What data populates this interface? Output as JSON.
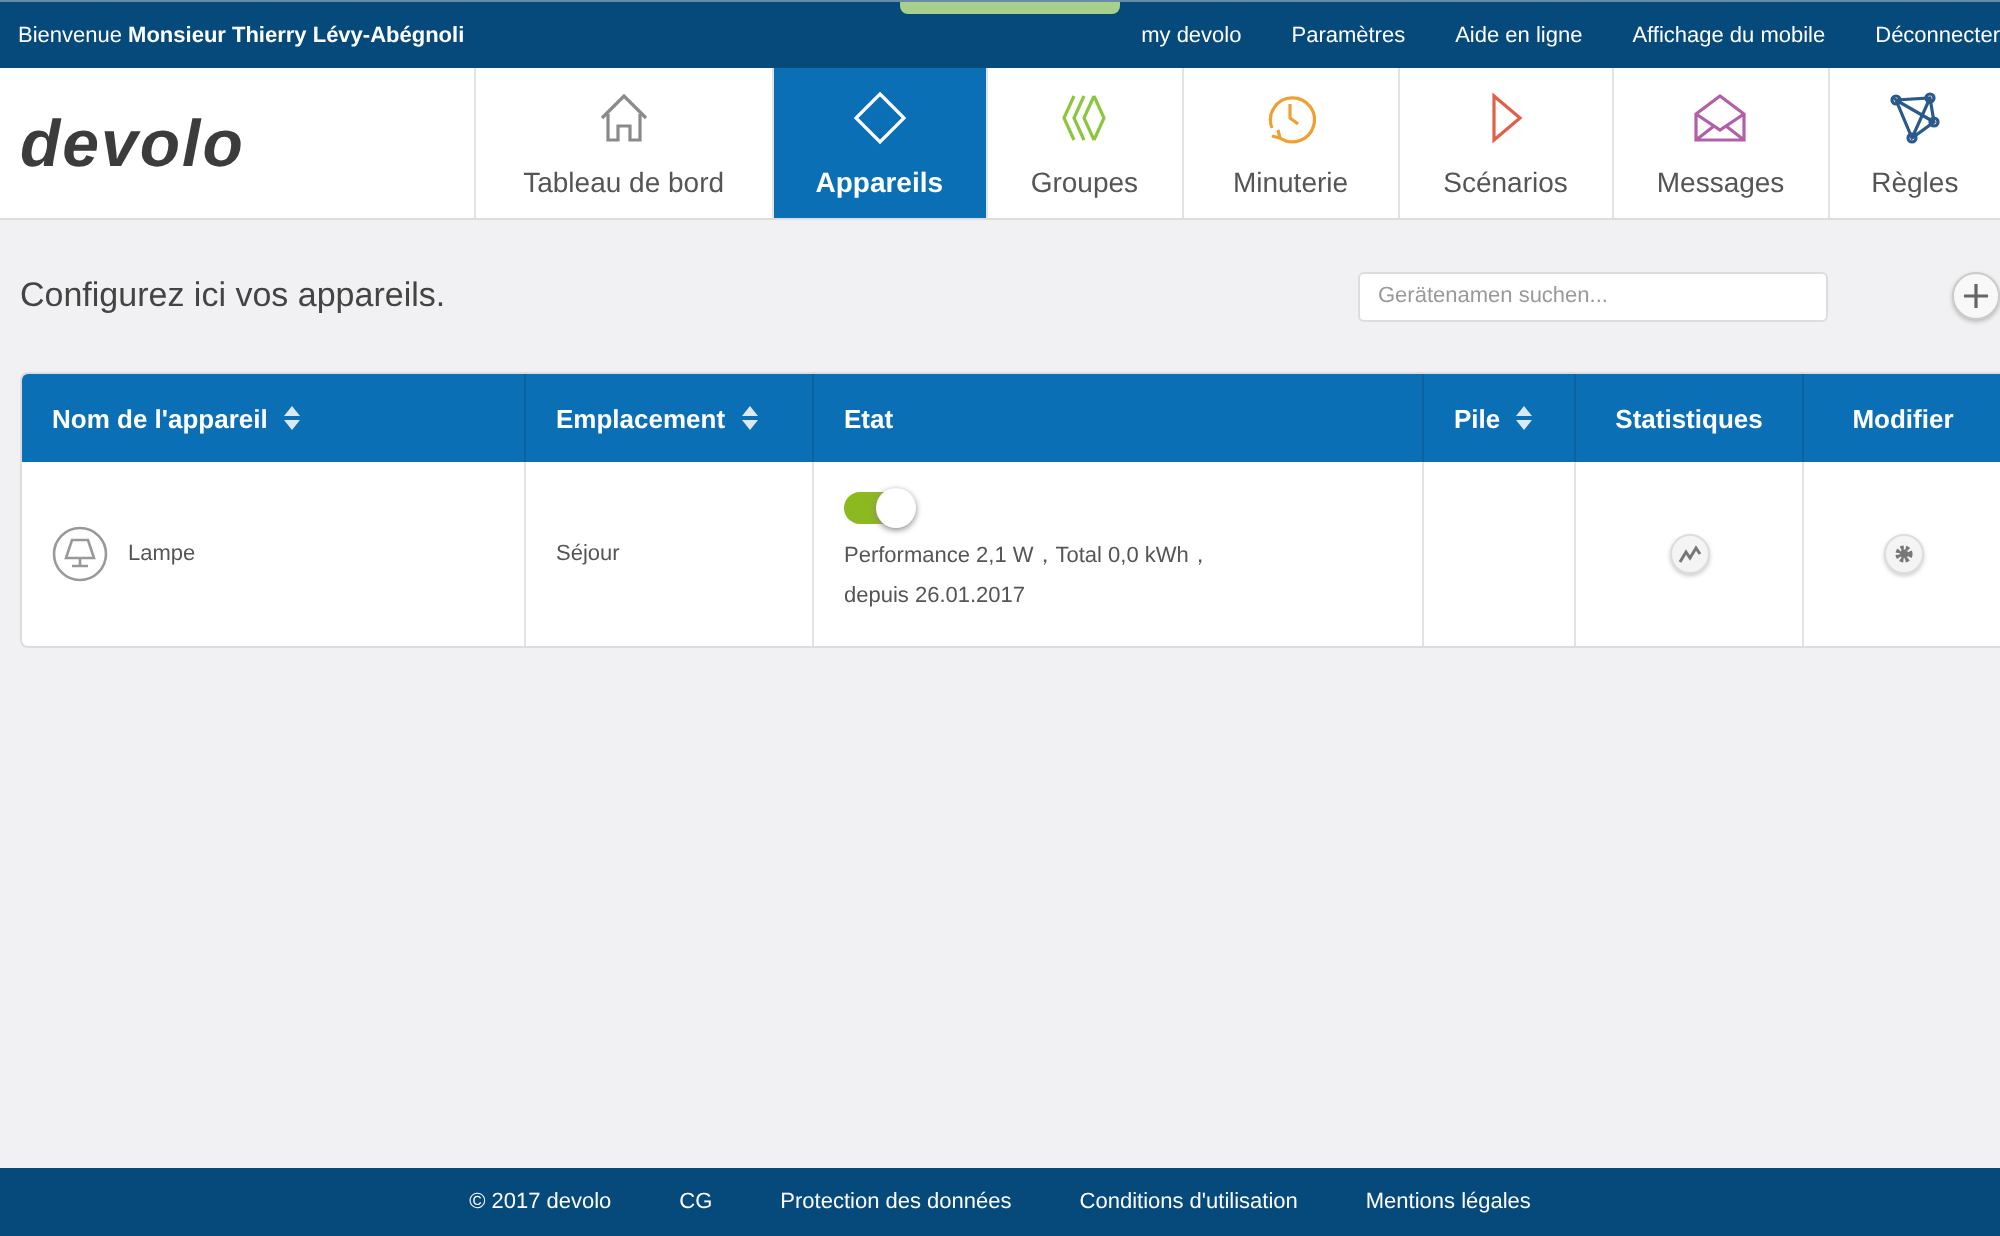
{
  "top_bar": {
    "welcome": "Bienvenue **Monsieur Thierry Lévy-Abégnoli**",
    "links": [
      "my devolo",
      "Paramètres",
      "Aide en ligne",
      "Affichage du mobile",
      "Déconnecter"
    ]
  },
  "logo": "devolo",
  "tabs": [
    {
      "label": "Tableau de bord",
      "kind": "home",
      "color": "#8a8a8a",
      "selected": false
    },
    {
      "label": "Appareils",
      "kind": "diamond",
      "color": "#ffffff",
      "selected": true
    },
    {
      "label": "Groupes",
      "kind": "groups",
      "color": "#8cc63f",
      "selected": false
    },
    {
      "label": "Minuterie",
      "kind": "clock",
      "color": "#f0a030",
      "selected": false
    },
    {
      "label": "Scénarios",
      "kind": "play",
      "color": "#e0604a",
      "selected": false
    },
    {
      "label": "Messages",
      "kind": "mail",
      "color": "#b060a8",
      "selected": false
    },
    {
      "label": "Règles",
      "kind": "network",
      "color": "#2a5a8a",
      "selected": false
    }
  ],
  "heading": "Configurez ici vos appareils.",
  "search": {
    "placeholder": "Gerätenamen suchen..."
  },
  "table": {
    "columns": [
      {
        "label": "Nom de l'appareil",
        "sortable": true
      },
      {
        "label": "Emplacement",
        "sortable": true
      },
      {
        "label": "Etat",
        "sortable": false
      },
      {
        "label": "Pile",
        "sortable": true
      },
      {
        "label": "Statistiques",
        "sortable": false
      },
      {
        "label": "Modifier",
        "sortable": false
      }
    ],
    "rows": [
      {
        "name": "Lampe",
        "location": "Séjour",
        "on": true,
        "status": "Performance 2,1 W，Total 0,0 kWh，",
        "since": "depuis 26.01.2017"
      }
    ]
  },
  "footer": [
    "© 2017 devolo",
    "CG",
    "Protection des données",
    "Conditions d'utilisation",
    "Mentions légales"
  ]
}
